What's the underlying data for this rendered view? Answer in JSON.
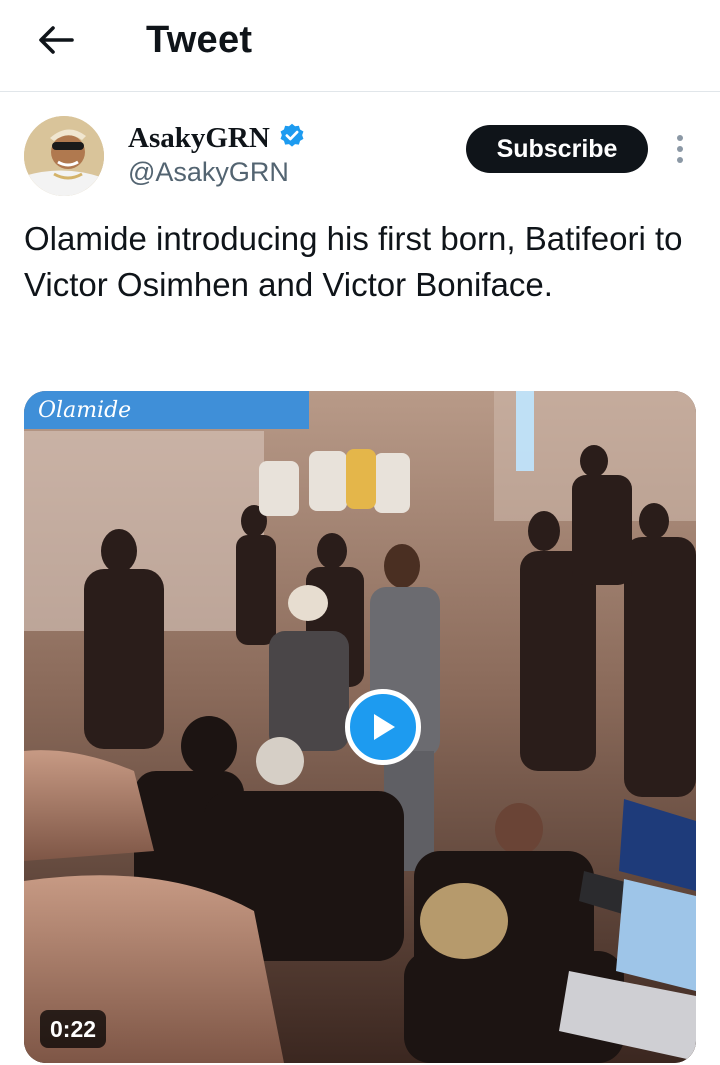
{
  "header": {
    "title": "Tweet",
    "back_icon": "arrow-left-icon"
  },
  "tweet": {
    "author_name": "AsakyGRN",
    "author_handle": "@AsakyGRN",
    "verified_icon": "verified-badge-icon",
    "verified_color": "#1d9bf0",
    "subscribe_label": "Subscribe",
    "more_icon": "more-vertical-icon",
    "text": "Olamide introducing his first born, Batifeori to Victor Osimhen and Victor Boniface."
  },
  "media": {
    "type": "video",
    "duration": "0:22",
    "play_icon": "play-icon",
    "banner_script": "Olamide"
  },
  "colors": {
    "accent": "#1d9bf0",
    "text_primary": "#0f1419",
    "text_secondary": "#536471",
    "button_bg": "#0f1419"
  }
}
